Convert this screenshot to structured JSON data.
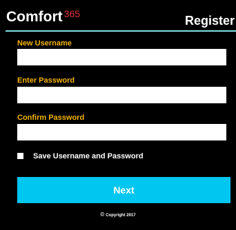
{
  "header": {
    "brand_name": "Comfort",
    "brand_number": "365",
    "register_label": "Register"
  },
  "form": {
    "username_label": "New Username",
    "username_value": "",
    "password_label": "Enter Password",
    "password_value": "",
    "confirm_label": "Confirm Password",
    "confirm_value": "",
    "save_checkbox_label": "Save Username and Password",
    "save_checked": false,
    "next_label": "Next"
  },
  "footer": {
    "copyright_symbol": "©",
    "copyright_text": "Copyright 2017"
  },
  "colors": {
    "background": "#000000",
    "label_yellow": "#f5b400",
    "accent_cyan": "#00c6f0",
    "divider_cyan": "#7fe3ea",
    "brand_red": "#e8303a"
  }
}
